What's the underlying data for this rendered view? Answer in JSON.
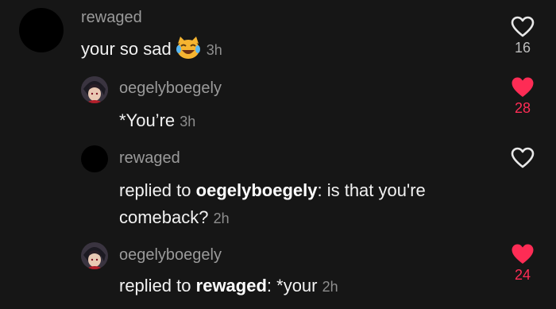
{
  "comments": [
    {
      "username": "rewaged",
      "text": "your so sad",
      "emoji": "crying-laughing-cat-emoji",
      "time": "3h",
      "likes": "16",
      "liked": false
    },
    {
      "username": "oegelyboegely",
      "text": "*You’re",
      "time": "3h",
      "likes": "28",
      "liked": true
    },
    {
      "username": "rewaged",
      "reply_prefix": "replied to",
      "reply_to": "oegelyboegely",
      "text_line1": ": is that you're",
      "text_line2": "comeback?",
      "time": "2h",
      "likes": "",
      "liked": false
    },
    {
      "username": "oegelyboegely",
      "reply_prefix": "replied to",
      "reply_to": "rewaged",
      "text": ": *your",
      "time": "2h",
      "likes": "24",
      "liked": true
    }
  ],
  "colors": {
    "background": "#161616",
    "username": "#9a9a9a",
    "text": "#f2f2f2",
    "liked": "#fe2c55"
  }
}
